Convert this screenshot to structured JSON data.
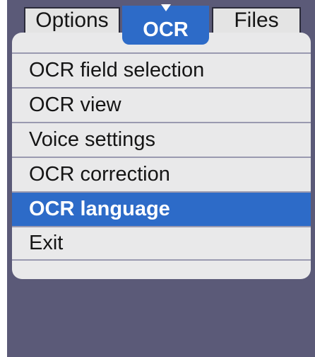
{
  "tabs": {
    "left": "Options",
    "active": "OCR",
    "right": "Files"
  },
  "menu": {
    "items": [
      {
        "label": "OCR field selection",
        "selected": false
      },
      {
        "label": "OCR view",
        "selected": false
      },
      {
        "label": "Voice settings",
        "selected": false
      },
      {
        "label": "OCR correction",
        "selected": false
      },
      {
        "label": "OCR language",
        "selected": true
      },
      {
        "label": "Exit",
        "selected": false
      }
    ]
  },
  "colors": {
    "screen_background": "#5b5a78",
    "menu_background": "#e9e9ea",
    "accent": "#2d6bc8",
    "tab_background": "#e4e4e4"
  },
  "icons": {
    "active_tab_marker": "triangle-down-icon"
  }
}
